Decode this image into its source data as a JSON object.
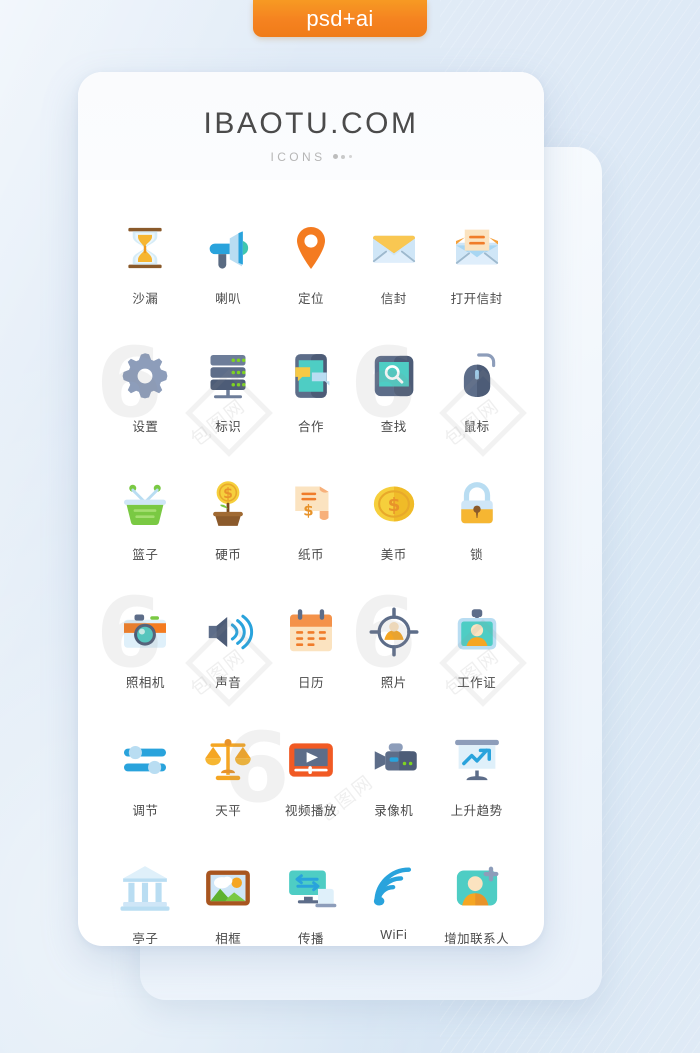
{
  "badge": {
    "label": "psd+ai"
  },
  "header": {
    "brand": "IBAOTU.COM",
    "subtitle": "ICONS"
  },
  "watermark": {
    "mark": "6",
    "text": "包图网"
  },
  "icons": [
    {
      "label": "沙漏",
      "name": "hourglass-icon"
    },
    {
      "label": "喇叭",
      "name": "megaphone-icon"
    },
    {
      "label": "定位",
      "name": "location-pin-icon"
    },
    {
      "label": "信封",
      "name": "envelope-icon"
    },
    {
      "label": "打开信封",
      "name": "open-envelope-icon"
    },
    {
      "label": "设置",
      "name": "gear-icon"
    },
    {
      "label": "标识",
      "name": "server-icon"
    },
    {
      "label": "合作",
      "name": "chat-cooperation-icon"
    },
    {
      "label": "查找",
      "name": "search-screen-icon"
    },
    {
      "label": "鼠标",
      "name": "mouse-icon"
    },
    {
      "label": "篮子",
      "name": "basket-icon"
    },
    {
      "label": "硬币",
      "name": "coin-plant-icon"
    },
    {
      "label": "纸币",
      "name": "banknote-icon"
    },
    {
      "label": "美币",
      "name": "dollar-coin-icon"
    },
    {
      "label": "锁",
      "name": "lock-icon"
    },
    {
      "label": "照相机",
      "name": "camera-icon"
    },
    {
      "label": "声音",
      "name": "sound-icon"
    },
    {
      "label": "日历",
      "name": "calendar-icon"
    },
    {
      "label": "照片",
      "name": "photo-focus-icon"
    },
    {
      "label": "工作证",
      "name": "id-badge-icon"
    },
    {
      "label": "调节",
      "name": "sliders-icon"
    },
    {
      "label": "天平",
      "name": "balance-scale-icon"
    },
    {
      "label": "视频播放",
      "name": "video-play-icon"
    },
    {
      "label": "录像机",
      "name": "video-camera-icon"
    },
    {
      "label": "上升趋势",
      "name": "trend-up-chart-icon"
    },
    {
      "label": "亭子",
      "name": "pavilion-bank-icon"
    },
    {
      "label": "相框",
      "name": "photo-frame-icon"
    },
    {
      "label": "传播",
      "name": "sync-devices-icon"
    },
    {
      "label": "WiFi",
      "name": "wifi-icon"
    },
    {
      "label": "增加联系人",
      "name": "add-contact-icon"
    }
  ],
  "colors": {
    "badge_orange": "#f58220",
    "background_blue": "#dce8f5",
    "card_white": "#ffffff",
    "label_gray": "#4a4a4a",
    "brand_gray": "#4b4b4b",
    "subtitle_gray": "#b6b6b6",
    "accent_amber": "#f5a623",
    "accent_blue": "#2196d6",
    "accent_slate": "#5b6b85",
    "accent_green": "#7ac943"
  }
}
